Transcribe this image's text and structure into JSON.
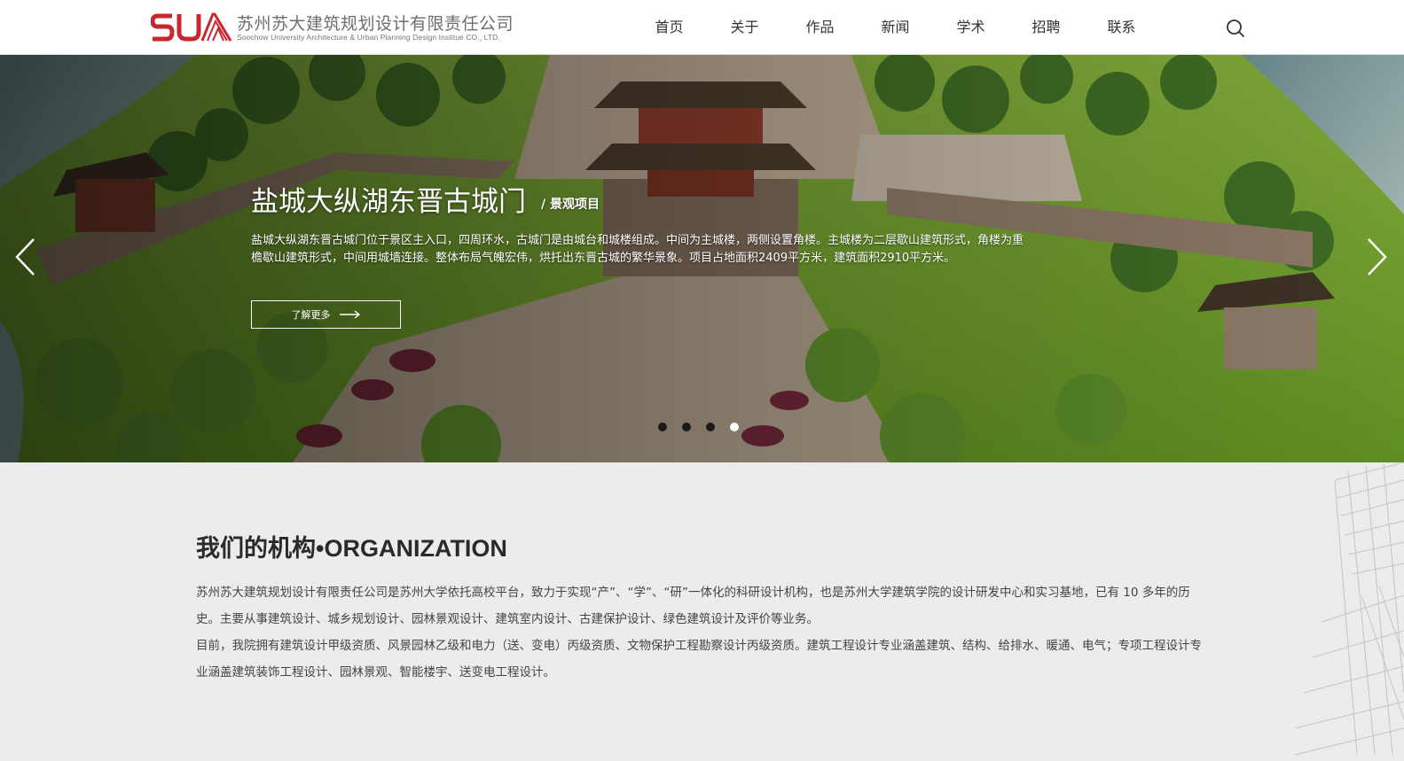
{
  "header": {
    "logo_mark": "SUA",
    "logo_cn": "苏州苏大建筑规划设计有限责任公司",
    "logo_en": "Soochow University Architecture & Urban Planning Design Institue CO., LTD.",
    "nav": [
      "首页",
      "关于",
      "作品",
      "新闻",
      "学术",
      "招聘",
      "联系"
    ],
    "search_icon": "search-icon"
  },
  "banner": {
    "title": "盐城大纵湖东晋古城门",
    "tag": "/ 景观项目",
    "description": "盐城大纵湖东晋古城门位于景区主入口，四周环水，古城门是由城台和城楼组成。中间为主城楼，两侧设置角楼。主城楼为二层歇山建筑形式，角楼为重檐歇山建筑形式，中间用城墙连接。整体布局气魄宏伟，烘托出东晋古城的繁华景象。项目占地面积2409平方米，建筑面积2910平方米。",
    "more_label": "了解更多",
    "prev_icon": "chevron-left-icon",
    "next_icon": "chevron-right-icon",
    "slides": 4,
    "active_slide": 4
  },
  "org": {
    "title": "我们的机构•ORGANIZATION",
    "paragraph1": "苏州苏大建筑规划设计有限责任公司是苏州大学依托高校平台，致力于实现“产”、“学”、“研”一体化的科研设计机构，也是苏州大学建筑学院的设计研发中心和实习基地，已有 10 多年的历史。主要从事建筑设计、城乡规划设计、园林景观设计、建筑室内设计、古建保护设计、绿色建筑设计及评价等业务。",
    "paragraph2": "目前，我院拥有建筑设计甲级资质、风景园林乙级和电力（送、变电）丙级资质、文物保护工程勘察设计丙级资质。建筑工程设计专业涵盖建筑、结构、给排水、暖通、电气；专项工程设计专业涵盖建筑装饰工程设计、园林景观、智能楼宇、送变电工程设计。"
  },
  "colors": {
    "brand_red": "#c8282d",
    "header_bg": "#ffffff",
    "section_bg": "#ececec"
  }
}
